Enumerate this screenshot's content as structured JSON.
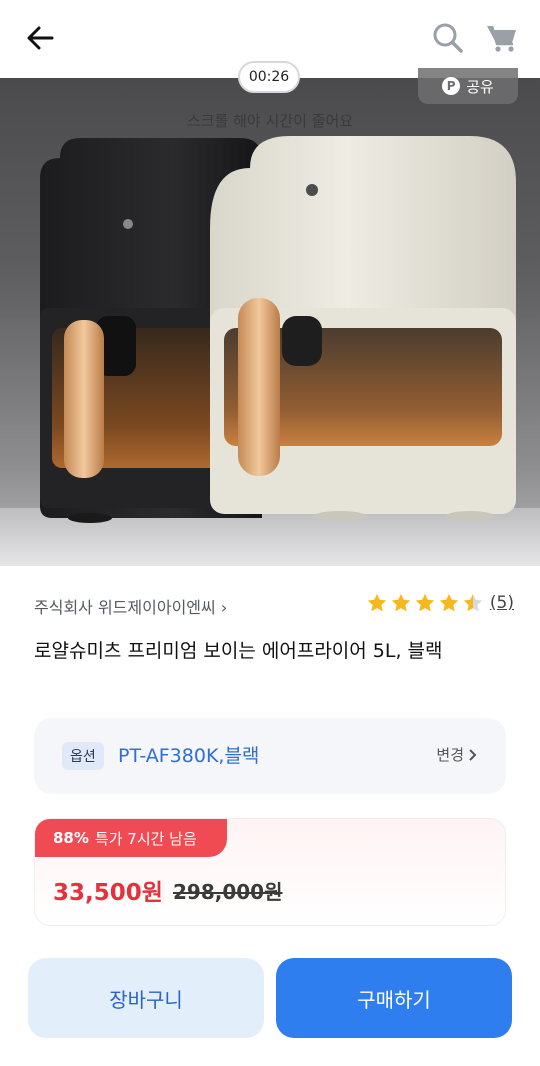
{
  "header": {
    "back_icon": "arrow-left-icon",
    "search_icon": "search-icon",
    "cart_icon": "cart-icon"
  },
  "hero": {
    "timer": "00:26",
    "scroll_hint": "스크롤 해야 시간이 줄어요",
    "share_label": "공유",
    "share_badge": "P"
  },
  "product": {
    "seller": "주식회사 위드제이아이엔씨",
    "rating": 4.5,
    "rating_count": "(5)",
    "title": "로얄슈미츠 프리미엄 보이는 에어프라이어 5L, 블랙"
  },
  "option": {
    "tag": "옵션",
    "value": "PT-AF380K,블랙",
    "change_label": "변경"
  },
  "price": {
    "discount": "88%",
    "deal_text": "특가 7시간 남음",
    "current": "33,500원",
    "original": "298,000원"
  },
  "actions": {
    "cart_label": "장바구니",
    "buy_label": "구매하기"
  },
  "colors": {
    "accent_blue": "#2f7ef0",
    "deal_red": "#f04a52",
    "price_red": "#e8303a",
    "star": "#f5b81d"
  }
}
